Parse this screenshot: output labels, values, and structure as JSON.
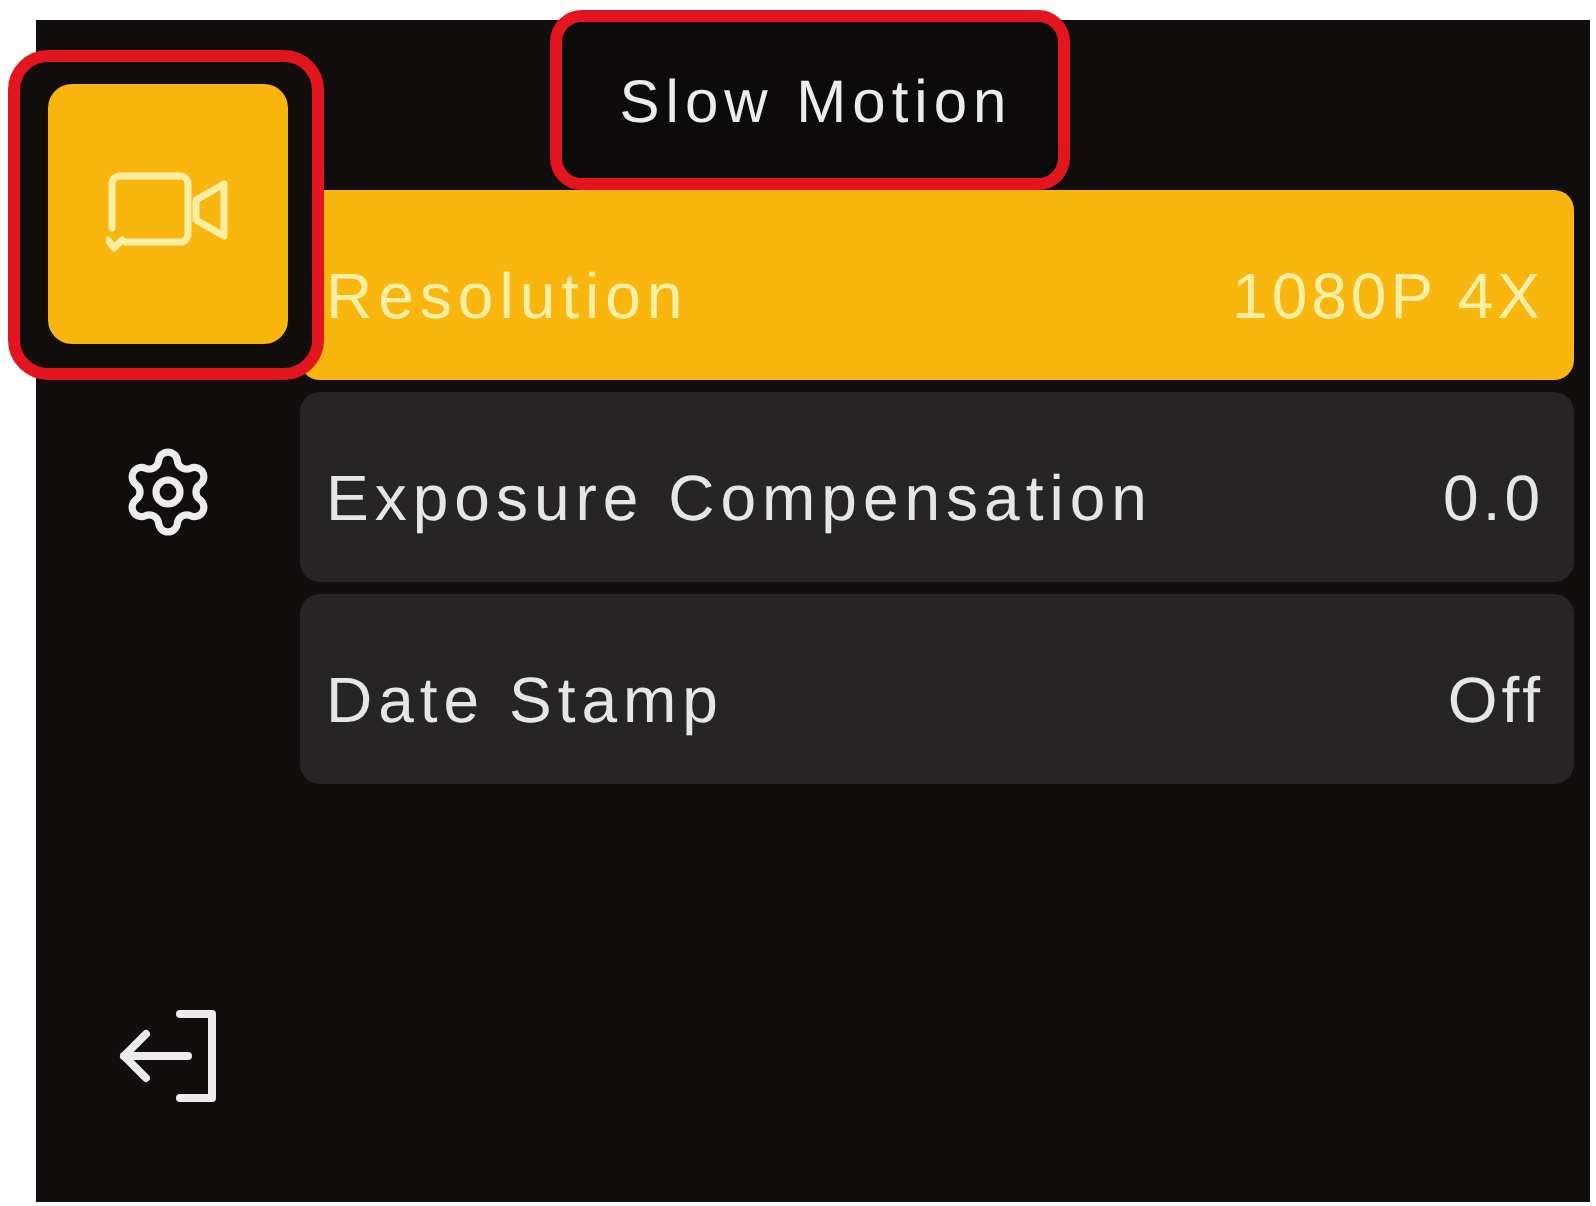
{
  "title": {
    "text": "Slow Motion",
    "highlighted": true
  },
  "sidebar": {
    "items": [
      {
        "kind": "video",
        "selected": true,
        "highlighted": true
      },
      {
        "kind": "settings",
        "selected": false,
        "highlighted": false
      },
      {
        "kind": "exit",
        "selected": false,
        "highlighted": false
      }
    ]
  },
  "menu": {
    "rows": [
      {
        "label": "Resolution",
        "value": "1080P 4X",
        "selected": true
      },
      {
        "label": "Exposure Compensation",
        "value": "0.0",
        "selected": false
      },
      {
        "label": "Date Stamp",
        "value": "Off",
        "selected": false
      }
    ]
  }
}
